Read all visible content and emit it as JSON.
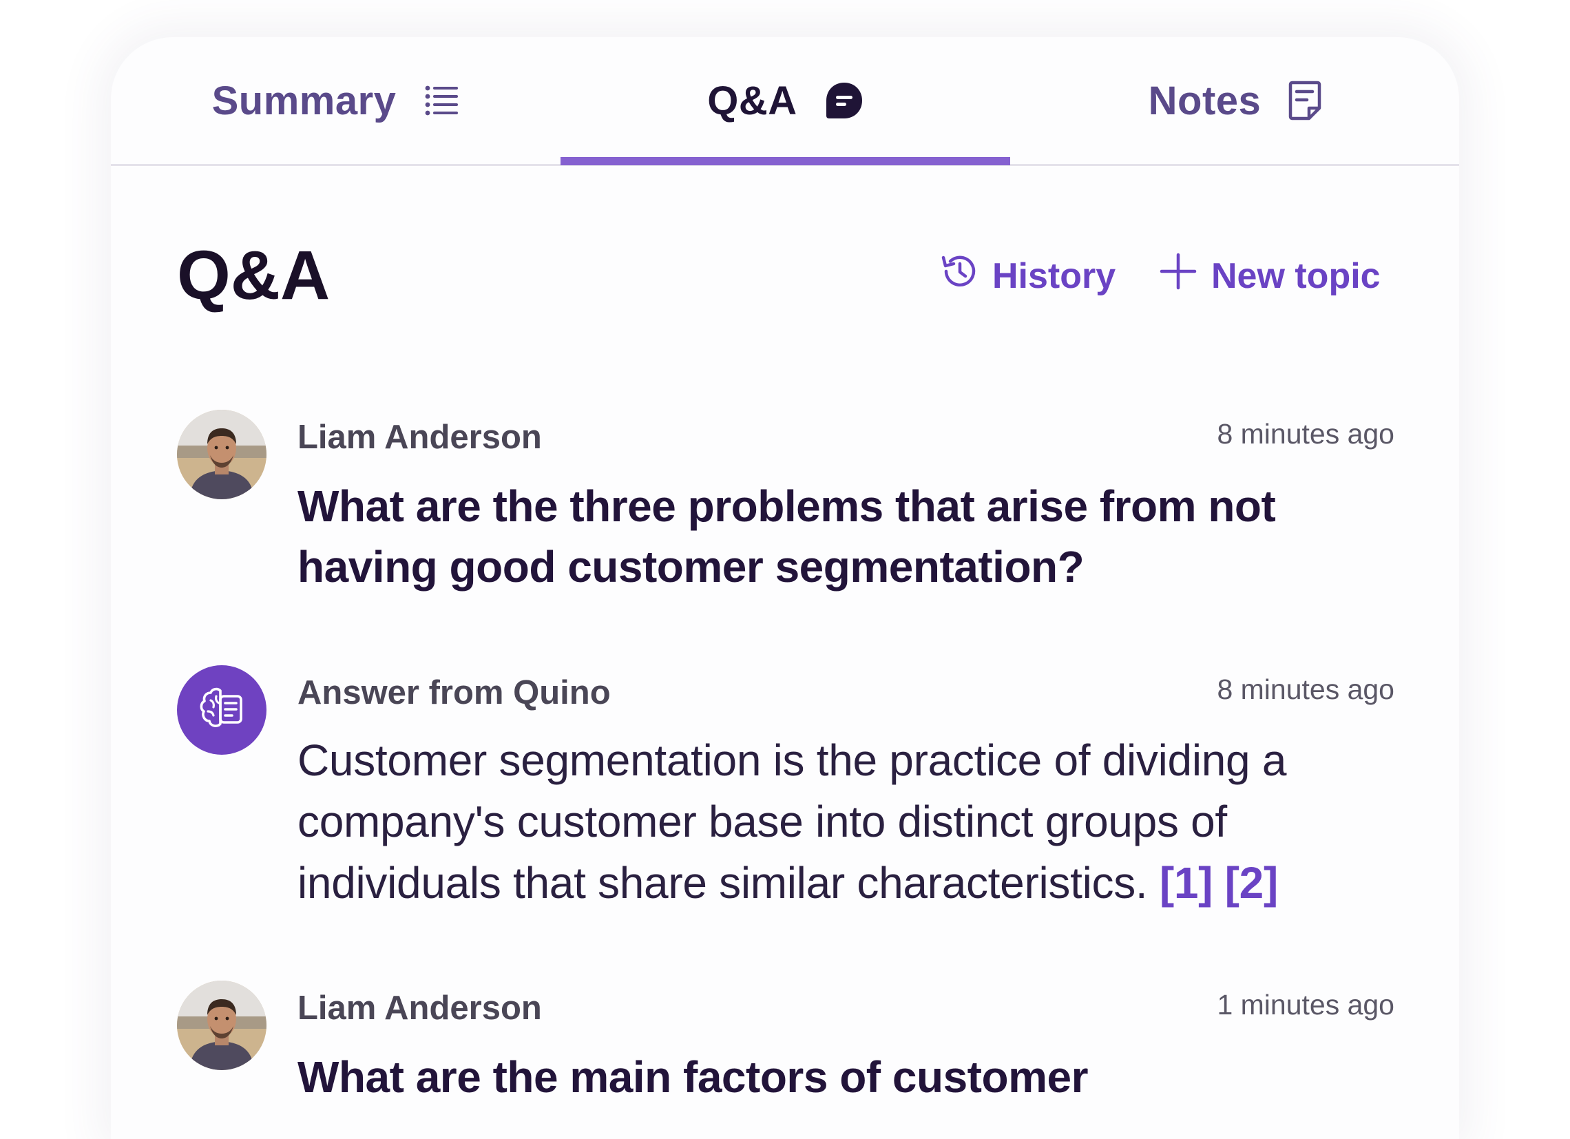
{
  "tabs": [
    {
      "label": "Summary",
      "icon": "list-icon",
      "active": false
    },
    {
      "label": "Q&A",
      "icon": "chat-bubble-icon",
      "active": true
    },
    {
      "label": "Notes",
      "icon": "note-icon",
      "active": false
    }
  ],
  "header": {
    "title": "Q&A",
    "history_label": "History",
    "new_topic_label": "New topic"
  },
  "messages": [
    {
      "author": "Liam Anderson",
      "time": "8 minutes ago",
      "text": "What are the three problems that arise from not having good customer segmentation?",
      "type": "question"
    },
    {
      "author": "Answer from Quino",
      "time": "8 minutes ago",
      "text": "Customer segmentation is the practice of dividing a company's customer base into distinct groups of individuals that share similar characteristics.",
      "citations": [
        "[1]",
        "[2]"
      ],
      "type": "answer"
    },
    {
      "author": "Liam Anderson",
      "time": "1 minutes ago",
      "text": "What are the main factors of customer",
      "type": "question"
    }
  ],
  "colors": {
    "accent": "#8561d0",
    "link": "#6a43c4",
    "bot_avatar": "#6f42c1",
    "heading": "#1a1028"
  }
}
